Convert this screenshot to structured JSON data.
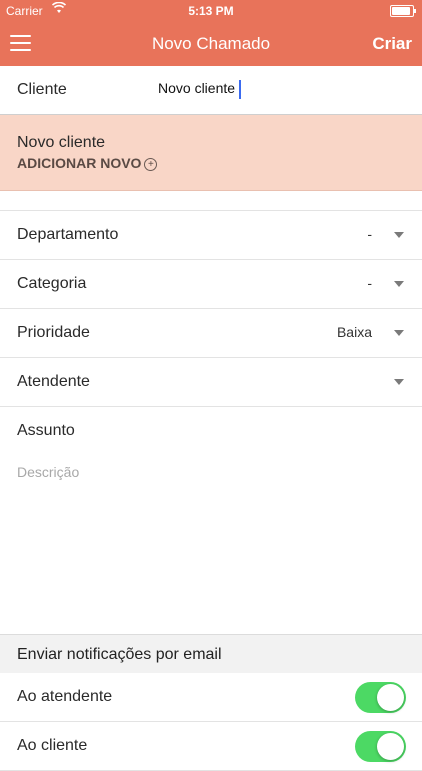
{
  "status": {
    "carrier": "Carrier",
    "time": "5:13 PM",
    "wifi_icon": "wifi-icon",
    "battery_icon": "battery-icon"
  },
  "navbar": {
    "title": "Novo Chamado",
    "action": "Criar",
    "menu_icon": "hamburger-icon",
    "color": "#e8735a"
  },
  "client": {
    "label": "Cliente",
    "value": "Novo cliente"
  },
  "suggestion": {
    "name": "Novo cliente",
    "add_label": "ADICIONAR NOVO",
    "add_icon": "plus-circle-icon",
    "background": "#f9d6c7"
  },
  "fields": [
    {
      "label": "Departamento",
      "value": "-"
    },
    {
      "label": "Categoria",
      "value": "-"
    },
    {
      "label": "Prioridade",
      "value": "Baixa"
    },
    {
      "label": "Atendente",
      "value": ""
    },
    {
      "label": "Assunto"
    }
  ],
  "description": {
    "placeholder": "Descrição"
  },
  "notifications": {
    "header": "Enviar notificações por email",
    "items": [
      {
        "label": "Ao atendente",
        "enabled": true
      },
      {
        "label": "Ao cliente",
        "enabled": true
      }
    ],
    "toggle_color": "#4cd964"
  }
}
